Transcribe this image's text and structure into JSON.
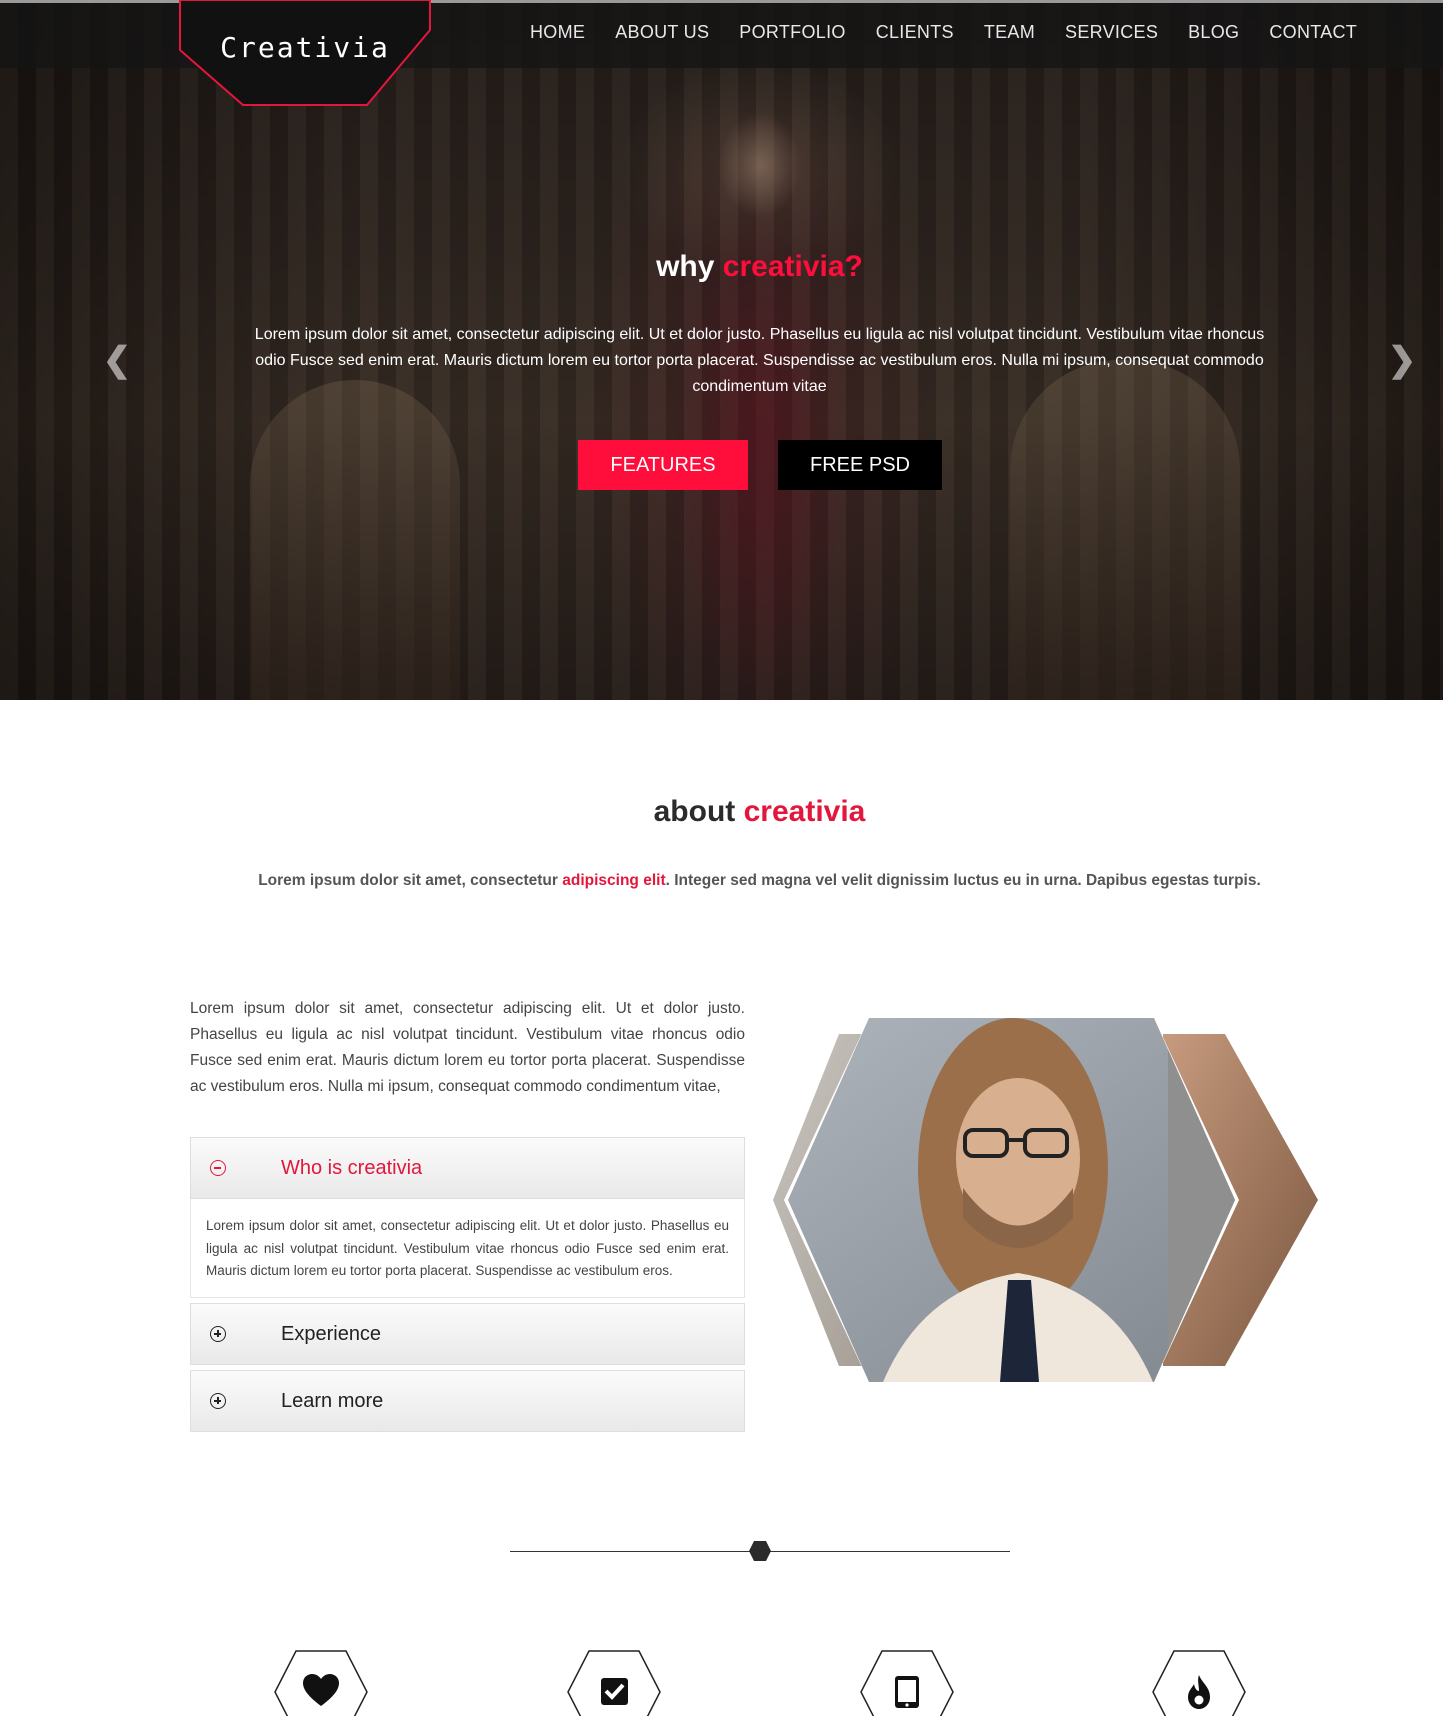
{
  "brand": {
    "name": "Creativia",
    "accent_color": "#ff0d3b"
  },
  "nav": {
    "items": [
      "HOME",
      "ABOUT US",
      "PORTFOLIO",
      "CLIENTS",
      "TEAM",
      "SERVICES",
      "BLOG",
      "CONTACT"
    ]
  },
  "hero": {
    "title_prefix": "why",
    "title_accent": "creativia?",
    "text": "Lorem ipsum dolor sit amet, consectetur adipiscing elit. Ut et dolor justo. Phasellus eu ligula ac nisl volutpat tincidunt. Vestibulum vitae rhoncus odio Fusce sed enim erat. Mauris dictum lorem eu tortor porta placerat. Suspendisse ac vestibulum eros. Nulla mi ipsum, consequat commodo condimentum vitae",
    "buttons": {
      "primary": "FEATURES",
      "secondary": "FREE PSD"
    },
    "prev_icon": "chevron-left-icon",
    "next_icon": "chevron-right-icon"
  },
  "about": {
    "title_prefix": "about",
    "title_accent": "creativia",
    "subtitle_before": "Lorem ipsum dolor sit amet, consectetur ",
    "subtitle_accent": "adipiscing elit",
    "subtitle_after": ". Integer sed magna vel velit dignissim luctus eu in urna. Dapibus egestas turpis.",
    "paragraph": "Lorem ipsum dolor sit amet, consectetur adipiscing elit. Ut et dolor justo. Phasellus eu ligula ac nisl volutpat tincidunt. Vestibulum vitae rhoncus odio Fusce sed enim erat. Mauris dictum lorem eu tortor porta placerat. Suspendisse ac vestibulum eros. Nulla mi ipsum, consequat commodo condimentum vitae,",
    "accordion": [
      {
        "label": "Who is creativia",
        "expanded": true,
        "body": "Lorem ipsum dolor sit amet, consectetur adipiscing elit. Ut et dolor justo. Phasellus eu ligula ac nisl volutpat tincidunt. Vestibulum vitae rhoncus odio Fusce sed enim erat. Mauris dictum lorem eu tortor porta placerat. Suspendisse ac vestibulum eros."
      },
      {
        "label": "Experience",
        "expanded": false
      },
      {
        "label": "Learn more",
        "expanded": false
      }
    ]
  },
  "features": {
    "icons": [
      "heart-icon",
      "checkbox-icon",
      "tablet-icon",
      "flame-icon"
    ]
  }
}
